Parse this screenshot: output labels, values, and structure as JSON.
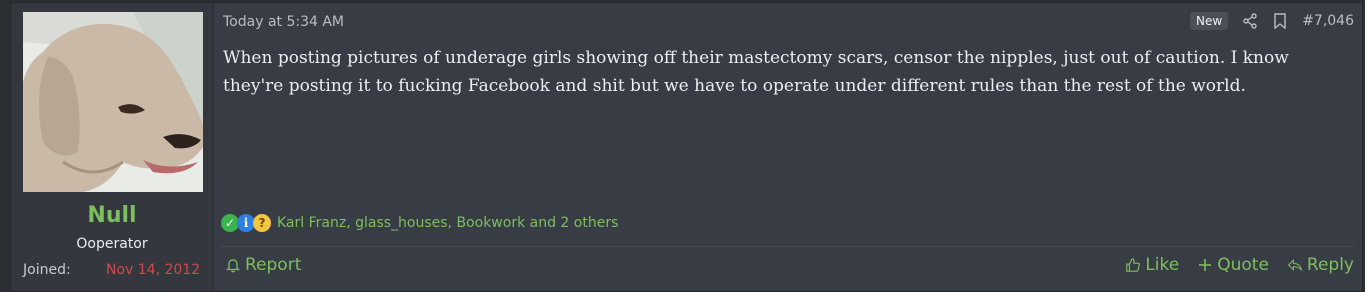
{
  "user": {
    "name": "Null",
    "title": "Ooperator",
    "joined_label": "Joined:",
    "joined_value": "Nov 14, 2012"
  },
  "post": {
    "timestamp": "Today at 5:34 AM",
    "badge": "New",
    "number": "#7,046",
    "body": "When posting pictures of underage girls showing off their mastectomy scars, censor the nipples, just out of caution. I know they're posting it to fucking Facebook and shit but we have to operate under different rules than the rest of the world."
  },
  "reactions": {
    "icons": [
      "check-reaction-icon",
      "info-reaction-icon",
      "thinking-reaction-icon"
    ],
    "names": "Karl Franz, glass_houses, Bookwork and 2 others"
  },
  "actions": {
    "report": "Report",
    "like": "Like",
    "quote": "Quote",
    "reply": "Reply"
  },
  "colors": {
    "background": "#383c44",
    "accent_green": "#7dbf5e",
    "joined_red": "#d14a4a"
  }
}
